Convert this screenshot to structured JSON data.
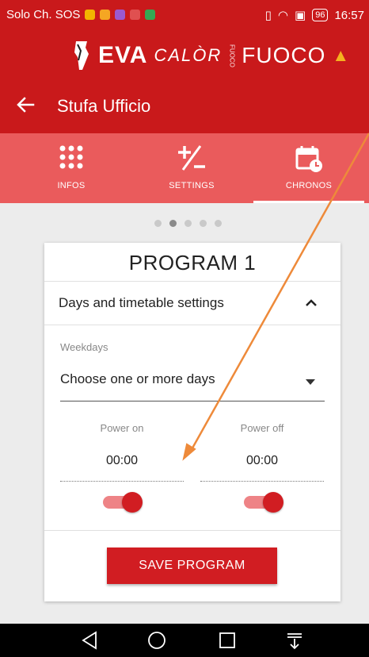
{
  "status_bar": {
    "carrier": "Solo Ch. SOS",
    "battery": "96",
    "time": "16:57"
  },
  "logo": {
    "brand": "EVA",
    "calor": "CALÒR",
    "small": "FUOCO",
    "fuoco": "FUOCO"
  },
  "app_bar": {
    "back_icon": "arrow-left-icon",
    "title": "Stufa Ufficio"
  },
  "tabs": [
    {
      "label": "INFOS",
      "icon": "grid-dots-icon",
      "active": false
    },
    {
      "label": "SETTINGS",
      "icon": "plus-minus-icon",
      "active": false
    },
    {
      "label": "CHRONOS",
      "icon": "calendar-clock-icon",
      "active": true
    }
  ],
  "pager": {
    "count": 5,
    "active_index": 1
  },
  "program": {
    "title": "PROGRAM 1",
    "section_title": "Days and timetable settings",
    "section_expanded": true,
    "weekdays_label": "Weekdays",
    "weekdays_value": "Choose one or more days",
    "power_on_label": "Power on",
    "power_on_value": "00:00",
    "power_off_label": "Power off",
    "power_off_value": "00:00",
    "power_on_enabled": true,
    "power_off_enabled": true,
    "save_label": "SAVE PROGRAM"
  },
  "colors": {
    "primary": "#c9191b",
    "tab_bar": "#ea5b5c",
    "accent": "#d11d22",
    "annotation_arrow": "#ee8a3a"
  }
}
